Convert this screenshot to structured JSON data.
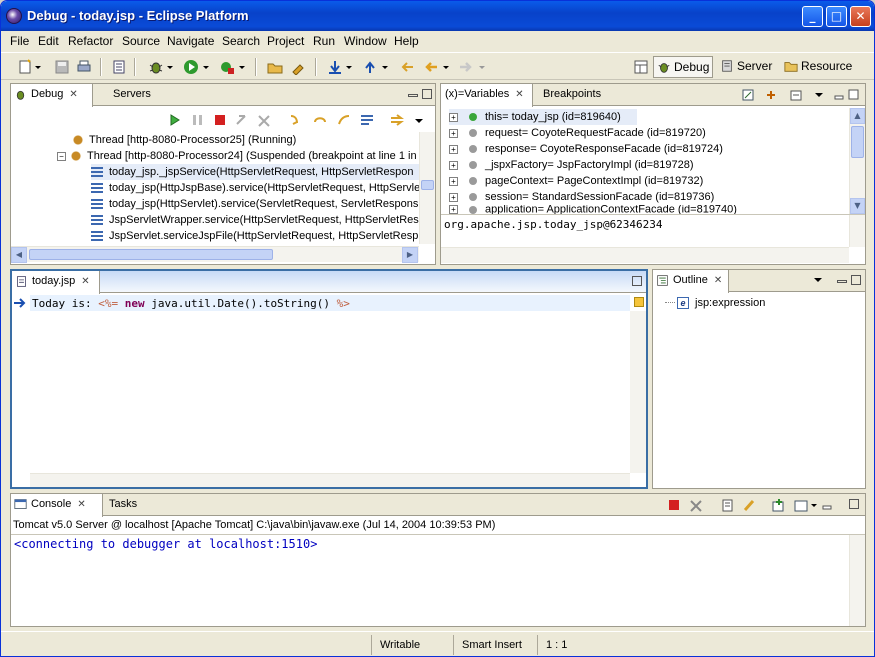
{
  "window": {
    "title": "Debug - today.jsp - Eclipse Platform",
    "min": "_",
    "max": "□",
    "close": "✕"
  },
  "menu": [
    "File",
    "Edit",
    "Refactor",
    "Source",
    "Navigate",
    "Search",
    "Project",
    "Run",
    "Window",
    "Help"
  ],
  "perspectives": [
    {
      "label": "Debug",
      "active": true
    },
    {
      "label": "Server",
      "active": false
    },
    {
      "label": "Resource",
      "active": false
    }
  ],
  "debug_view": {
    "tabs": [
      {
        "label": "Debug",
        "active": true
      },
      {
        "label": "Servers",
        "active": false
      }
    ],
    "rows": [
      {
        "text": "Thread [http-8080-Processor25] (Running)",
        "kind": "thread",
        "indent": 60
      },
      {
        "text": "Thread [http-8080-Processor24] (Suspended (breakpoint at line 1 in",
        "kind": "thread-susp",
        "indent": 55
      },
      {
        "text": "today_jsp._jspService(HttpServletRequest, HttpServletRespon",
        "kind": "frame",
        "indent": 88,
        "selected": true
      },
      {
        "text": "today_jsp(HttpJspBase).service(HttpServletRequest, HttpServle",
        "kind": "frame",
        "indent": 88
      },
      {
        "text": "today_jsp(HttpServlet).service(ServletRequest, ServletRespons",
        "kind": "frame",
        "indent": 88
      },
      {
        "text": "JspServletWrapper.service(HttpServletRequest, HttpServletRes",
        "kind": "frame",
        "indent": 88
      },
      {
        "text": "JspServlet.serviceJspFile(HttpServletRequest, HttpServletResp",
        "kind": "frame",
        "indent": 88
      }
    ]
  },
  "variables_view": {
    "tabs": [
      {
        "label": "(x)=Variables",
        "active": true
      },
      {
        "label": "Breakpoints",
        "active": false
      }
    ],
    "rows": [
      {
        "text": "this= today_jsp  (id=819640)",
        "dot": "#3aa63a",
        "selected": true
      },
      {
        "text": "request= CoyoteRequestFacade  (id=819720)",
        "dot": "#9a9a9a"
      },
      {
        "text": "response= CoyoteResponseFacade  (id=819724)",
        "dot": "#9a9a9a"
      },
      {
        "text": "_jspxFactory= JspFactoryImpl  (id=819728)",
        "dot": "#9a9a9a"
      },
      {
        "text": "pageContext= PageContextImpl  (id=819732)",
        "dot": "#9a9a9a"
      },
      {
        "text": "session= StandardSessionFacade  (id=819736)",
        "dot": "#9a9a9a"
      },
      {
        "text": "application= ApplicationContextFacade  (id=819740)",
        "dot": "#9a9a9a"
      }
    ],
    "detail": "org.apache.jsp.today_jsp@62346234"
  },
  "editor": {
    "tab": "today.jsp",
    "line": {
      "text": "Today is: ",
      "open": "<%=",
      "kw": "new",
      "expr": " java.util.Date().toString() ",
      "close": "%>"
    }
  },
  "outline": {
    "tab": "Outline",
    "item": "jsp:expression",
    "item_icon": "e"
  },
  "console": {
    "tabs": [
      {
        "label": "Console",
        "active": true
      },
      {
        "label": "Tasks",
        "active": false
      }
    ],
    "header": "Tomcat v5.0 Server @ localhost [Apache Tomcat] C:\\java\\bin\\javaw.exe (Jul 14, 2004 10:39:53 PM)",
    "output": "<connecting to debugger at localhost:1510>"
  },
  "status": {
    "writable": "Writable",
    "insert": "Smart Insert",
    "position": "1 : 1"
  },
  "colors": {
    "accent": "#3a6ea5",
    "keyword": "#7f0055",
    "jsp_tag": "#bf5f3f",
    "console_text": "#0000c0"
  }
}
